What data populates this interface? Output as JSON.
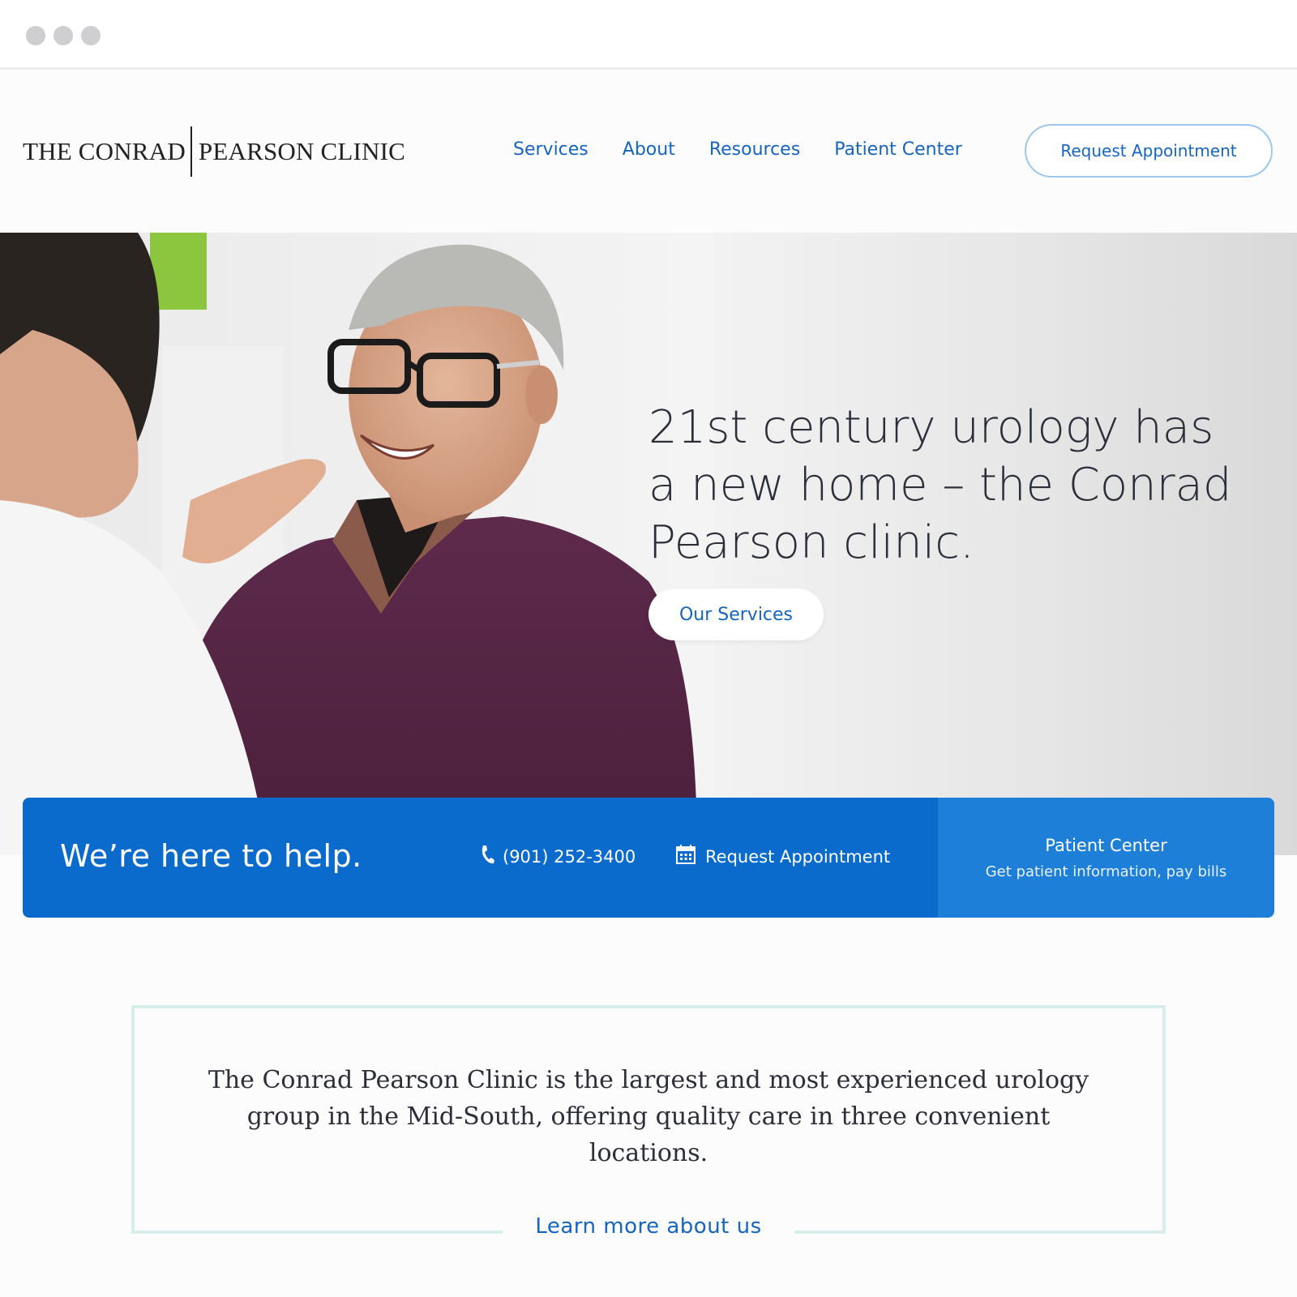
{
  "brand": {
    "logo_left": "THE CONRAD",
    "logo_right": "PEARSON CLINIC"
  },
  "nav": {
    "items": [
      {
        "label": "Services"
      },
      {
        "label": "About"
      },
      {
        "label": "Resources"
      },
      {
        "label": "Patient Center"
      }
    ],
    "cta_label": "Request Appointment"
  },
  "hero": {
    "headline": "21st century urology has a new home – the Conrad Pearson clinic.",
    "button_label": "Our Services"
  },
  "help_bar": {
    "title": "We’re here to help.",
    "phone": "(901) 252-3400",
    "appointment_label": "Request Appointment",
    "patient_center_title": "Patient Center",
    "patient_center_sub": "Get patient information, pay bills"
  },
  "about": {
    "text": "The Conrad Pearson Clinic is the largest and most experienced urology group in the Mid-South, offering quality care in three convenient locations.",
    "link_label": "Learn more about us"
  },
  "colors": {
    "primary_blue": "#0a6bcd",
    "secondary_blue": "#1d7fd8",
    "link_blue": "#1565c0",
    "frame_mint": "#d6ede9"
  },
  "icons": [
    "phone-icon",
    "calendar-icon"
  ]
}
